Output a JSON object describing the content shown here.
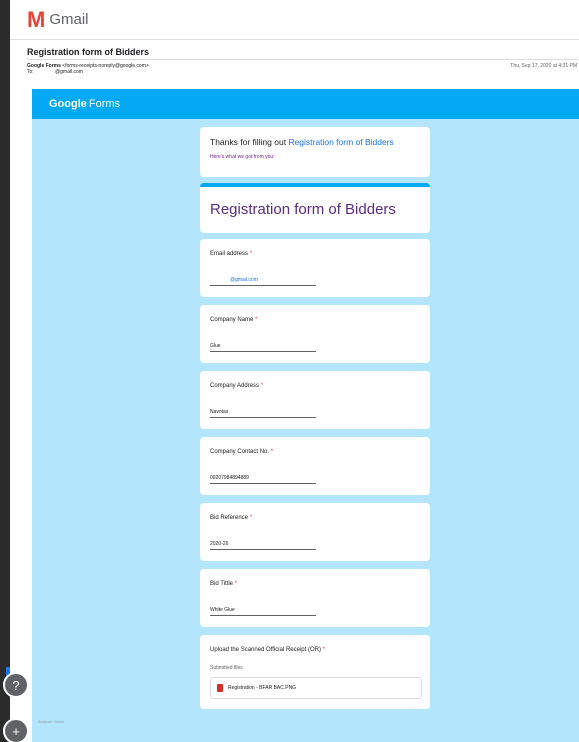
{
  "gmail": {
    "logo_text": "Gmail",
    "subject": "Registration form of Bidders",
    "sender_name": "Google Forms",
    "sender_email": "<forms-receipts-noreply@google.com>",
    "to_label": "To:",
    "to_value": "@gmail.com",
    "date": "Thu, Sep 17, 2020 at 4:31 PM"
  },
  "forms_banner": {
    "google": "Google",
    "forms": "Forms"
  },
  "thanks": {
    "prefix": "Thanks for filling out ",
    "link": "Registration form of Bidders",
    "subtitle": "Here's what we got from you:"
  },
  "form_title": "Registration form of Bidders",
  "required_mark": "*",
  "questions": [
    {
      "label": "Email address",
      "answer": "@gmail.com"
    },
    {
      "label": "Company Name",
      "answer": "Glue"
    },
    {
      "label": "Company Address",
      "answer": "Navotas"
    },
    {
      "label": "Company Contact No.",
      "answer": "09207984894889"
    },
    {
      "label": "Bid Reference",
      "answer": "2020-26"
    },
    {
      "label": "Bid Tittle",
      "answer": "White Glue"
    }
  ],
  "upload": {
    "label": "Upload the Scanned Official Receipt (OR)",
    "submitted_label": "Submitted files",
    "file_name": "Registration - BFAR BAC.PNG"
  },
  "footer": "Bulacan Hahm",
  "rail_icons": {
    "upper": "?",
    "lower": "+"
  }
}
